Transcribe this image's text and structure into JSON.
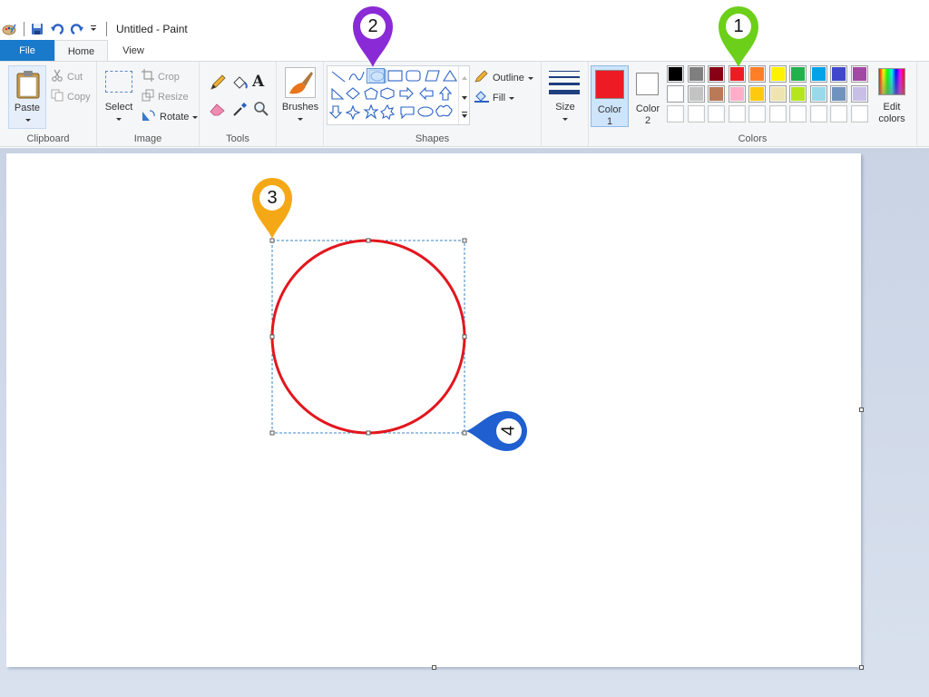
{
  "window": {
    "title": "Untitled - Paint"
  },
  "tabs": [
    {
      "label": "File"
    },
    {
      "label": "Home"
    },
    {
      "label": "View"
    }
  ],
  "clipboard": {
    "paste": "Paste",
    "cut": "Cut",
    "copy": "Copy",
    "group": "Clipboard"
  },
  "image": {
    "select": "Select",
    "crop": "Crop",
    "resize": "Resize",
    "rotate": "Rotate",
    "group": "Image"
  },
  "tools": {
    "group": "Tools"
  },
  "brushes": {
    "label": "Brushes"
  },
  "shapes": {
    "outline": "Outline",
    "fill": "Fill",
    "group": "Shapes"
  },
  "size": {
    "label": "Size"
  },
  "colors": {
    "color1": "Color",
    "color1_num": "1",
    "color2": "Color",
    "color2_num": "2",
    "edit": "Edit",
    "edit2": "colors",
    "group": "Colors",
    "color1_value": "#ed1c24",
    "color2_value": "#ffffff",
    "row1": [
      "#000000",
      "#7f7f7f",
      "#880015",
      "#ed1c24",
      "#ff7f27",
      "#fff200",
      "#22b14c",
      "#00a2e8",
      "#3f48cc",
      "#a349a4"
    ],
    "row2": [
      "#ffffff",
      "#c3c3c3",
      "#b97a57",
      "#ffaec9",
      "#ffc90e",
      "#efe4b0",
      "#b5e61d",
      "#99d9ea",
      "#7092be",
      "#c8bfe7"
    ],
    "row3": [
      "#ffffff",
      "#ffffff",
      "#ffffff",
      "#ffffff",
      "#ffffff",
      "#ffffff",
      "#ffffff",
      "#ffffff",
      "#ffffff",
      "#ffffff"
    ]
  },
  "pins": [
    {
      "label": "1",
      "color": "#6ccf1a"
    },
    {
      "label": "2",
      "color": "#8a2ad6"
    },
    {
      "label": "3",
      "color": "#f5a815"
    },
    {
      "label": "4",
      "color": "#1f5fd0"
    }
  ],
  "drawing": {
    "shape": "circle",
    "stroke": "#e3161d"
  }
}
